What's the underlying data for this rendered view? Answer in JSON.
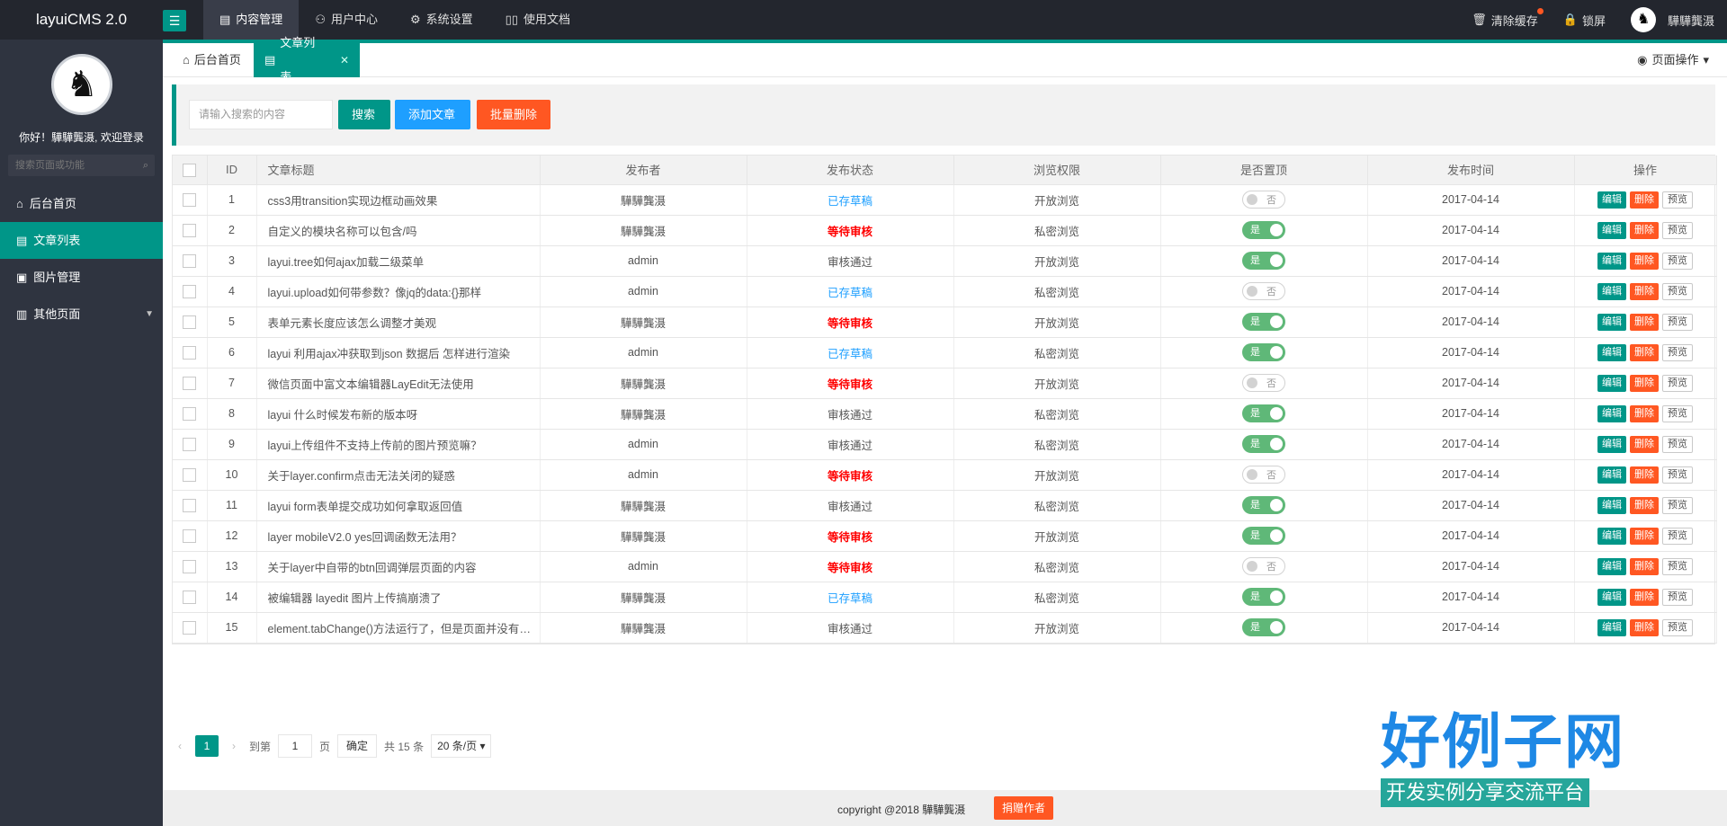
{
  "app": {
    "title": "layuiCMS 2.0"
  },
  "topnav": [
    {
      "icon": "document-icon",
      "label": "内容管理"
    },
    {
      "icon": "users-icon",
      "label": "用户中心"
    },
    {
      "icon": "gear-icon",
      "label": "系统设置"
    },
    {
      "icon": "book-icon",
      "label": "使用文档"
    }
  ],
  "topright": {
    "clear_cache": "清除缓存",
    "lock": "锁屏",
    "username": "驊驊龔滠"
  },
  "sidebar": {
    "welcome": "你好！驊驊龔滠, 欢迎登录",
    "search_placeholder": "搜索页面或功能",
    "items": [
      {
        "icon": "home-icon",
        "label": "后台首页"
      },
      {
        "icon": "list-icon",
        "label": "文章列表"
      },
      {
        "icon": "image-icon",
        "label": "图片管理"
      },
      {
        "icon": "pages-icon",
        "label": "其他页面"
      }
    ]
  },
  "tabs": [
    {
      "label": "后台首页"
    },
    {
      "label": "文章列表"
    }
  ],
  "page_ops": "页面操作",
  "toolbar": {
    "search_placeholder": "请输入搜索的内容",
    "search": "搜索",
    "add": "添加文章",
    "batch_delete": "批量删除"
  },
  "table": {
    "headers": [
      "ID",
      "文章标题",
      "发布者",
      "发布状态",
      "浏览权限",
      "是否置顶",
      "发布时间",
      "操作"
    ],
    "op_labels": {
      "edit": "编辑",
      "delete": "删除",
      "preview": "预览"
    },
    "toggle_labels": {
      "on": "是",
      "off": "否"
    },
    "rows": [
      {
        "id": "1",
        "title": "css3用transition实现边框动画效果",
        "author": "驊驊龔滠",
        "status": "已存草稿",
        "status_type": "draft",
        "perm": "开放浏览",
        "top": false,
        "date": "2017-04-14"
      },
      {
        "id": "2",
        "title": "自定义的模块名称可以包含/吗",
        "author": "驊驊龔滠",
        "status": "等待审核",
        "status_type": "wait",
        "perm": "私密浏览",
        "top": true,
        "date": "2017-04-14"
      },
      {
        "id": "3",
        "title": "layui.tree如何ajax加载二级菜单",
        "author": "admin",
        "status": "审核通过",
        "status_type": "pass",
        "perm": "开放浏览",
        "top": true,
        "date": "2017-04-14"
      },
      {
        "id": "4",
        "title": "layui.upload如何带参数？像jq的data:{}那样",
        "author": "admin",
        "status": "已存草稿",
        "status_type": "draft",
        "perm": "私密浏览",
        "top": false,
        "date": "2017-04-14"
      },
      {
        "id": "5",
        "title": "表单元素长度应该怎么调整才美观",
        "author": "驊驊龔滠",
        "status": "等待审核",
        "status_type": "wait",
        "perm": "开放浏览",
        "top": true,
        "date": "2017-04-14"
      },
      {
        "id": "6",
        "title": "layui 利用ajax冲获取到json 数据后 怎样进行渲染",
        "author": "admin",
        "status": "已存草稿",
        "status_type": "draft",
        "perm": "私密浏览",
        "top": true,
        "date": "2017-04-14"
      },
      {
        "id": "7",
        "title": "微信页面中富文本编辑器LayEdit无法使用",
        "author": "驊驊龔滠",
        "status": "等待审核",
        "status_type": "wait",
        "perm": "开放浏览",
        "top": false,
        "date": "2017-04-14"
      },
      {
        "id": "8",
        "title": "layui 什么时候发布新的版本呀",
        "author": "驊驊龔滠",
        "status": "审核通过",
        "status_type": "pass",
        "perm": "私密浏览",
        "top": true,
        "date": "2017-04-14"
      },
      {
        "id": "9",
        "title": "layui上传组件不支持上传前的图片预览嘛？",
        "author": "admin",
        "status": "审核通过",
        "status_type": "pass",
        "perm": "私密浏览",
        "top": true,
        "date": "2017-04-14"
      },
      {
        "id": "10",
        "title": "关于layer.confirm点击无法关闭的疑惑",
        "author": "admin",
        "status": "等待审核",
        "status_type": "wait",
        "perm": "开放浏览",
        "top": false,
        "date": "2017-04-14"
      },
      {
        "id": "11",
        "title": "layui form表单提交成功如何拿取返回值",
        "author": "驊驊龔滠",
        "status": "审核通过",
        "status_type": "pass",
        "perm": "私密浏览",
        "top": true,
        "date": "2017-04-14"
      },
      {
        "id": "12",
        "title": "layer mobileV2.0 yes回调函数无法用？",
        "author": "驊驊龔滠",
        "status": "等待审核",
        "status_type": "wait",
        "perm": "开放浏览",
        "top": true,
        "date": "2017-04-14"
      },
      {
        "id": "13",
        "title": "关于layer中自带的btn回调弹层页面的内容",
        "author": "admin",
        "status": "等待审核",
        "status_type": "wait",
        "perm": "私密浏览",
        "top": false,
        "date": "2017-04-14"
      },
      {
        "id": "14",
        "title": "被编辑器 layedit 图片上传搞崩溃了",
        "author": "驊驊龔滠",
        "status": "已存草稿",
        "status_type": "draft",
        "perm": "私密浏览",
        "top": true,
        "date": "2017-04-14"
      },
      {
        "id": "15",
        "title": "element.tabChange()方法运行了，但是页面并没有切换",
        "author": "驊驊龔滠",
        "status": "审核通过",
        "status_type": "pass",
        "perm": "开放浏览",
        "top": true,
        "date": "2017-04-14"
      }
    ]
  },
  "pager": {
    "current": "1",
    "goto": "到第",
    "page_value": "1",
    "page_unit": "页",
    "confirm": "确定",
    "total": "共 15 条",
    "per_page": "20 条/页"
  },
  "footer": {
    "copyright": "copyright @2018 驊驊龔滠",
    "donate": "捐赠作者"
  },
  "watermark": {
    "big": "好例子网",
    "small": "开发实例分享交流平台"
  }
}
